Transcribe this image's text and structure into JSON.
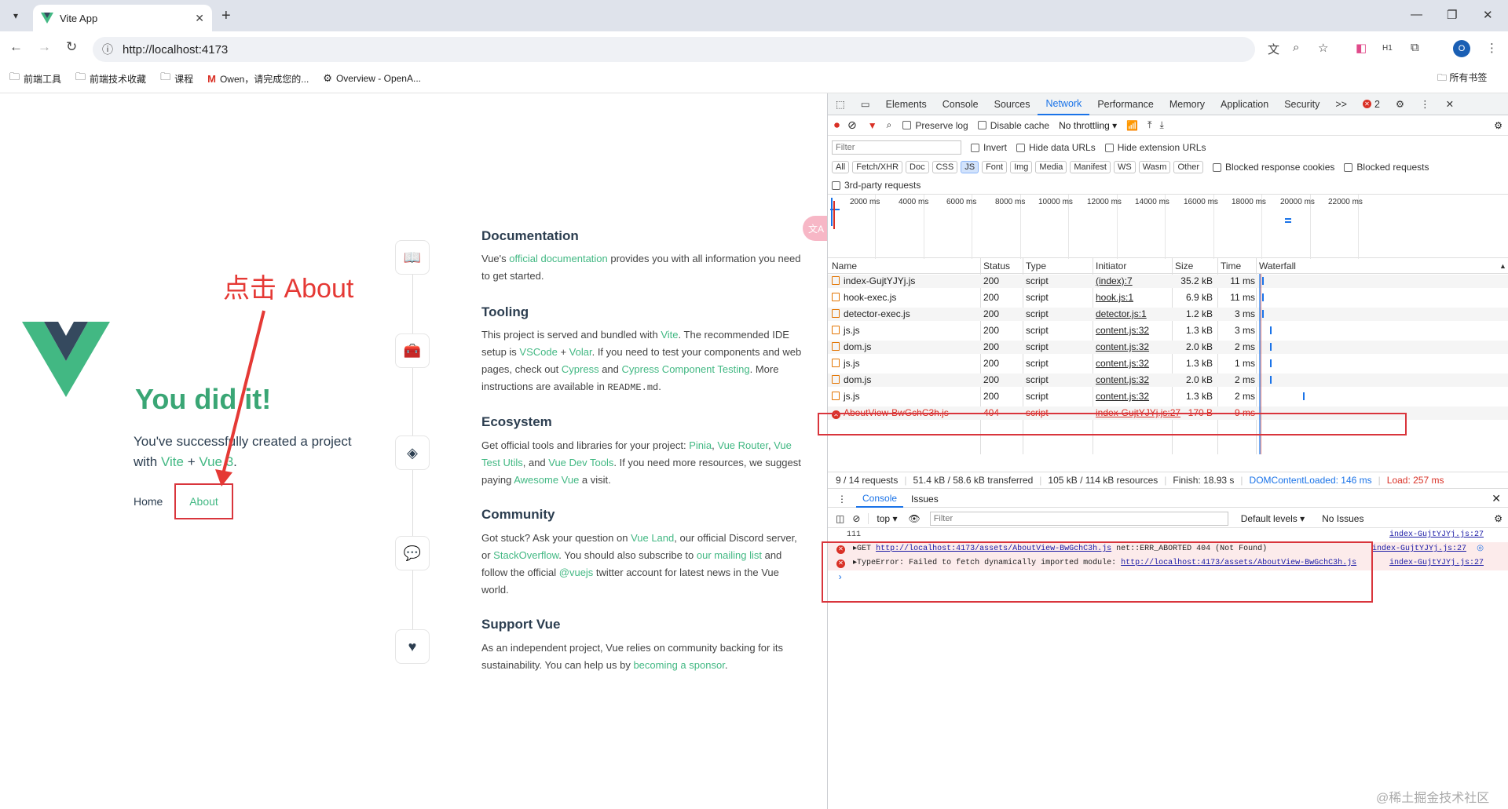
{
  "browser": {
    "tab_title": "Vite App",
    "url": "http://localhost:4173",
    "bookmarks": [
      "前端工具",
      "前端技术收藏",
      "课程",
      "Owen，请完成您的...",
      "Overview - OpenA..."
    ],
    "bookmarks_right": "所有书签",
    "profile_initial": "O"
  },
  "page": {
    "annotation": "点击 About",
    "heading": "You did it!",
    "created_prefix": "You've successfully created a project with",
    "created_vite": "Vite",
    "created_plus": "+",
    "created_vue": "Vue 3",
    "created_suffix": ".",
    "nav_home": "Home",
    "nav_about": "About",
    "translate_badge": "文A",
    "sections": [
      {
        "title": "Documentation",
        "parts": [
          "Vue's ",
          "official documentation",
          " provides you with all information you need to get started."
        ]
      },
      {
        "title": "Tooling",
        "parts": [
          "This project is served and bundled with ",
          "Vite",
          ". The recommended IDE setup is ",
          "VSCode",
          " + ",
          "Volar",
          ". If you need to test your components and web pages, check out ",
          "Cypress",
          " and ",
          "Cypress Component Testing",
          ". More instructions are available in ",
          "README.md",
          "."
        ]
      },
      {
        "title": "Ecosystem",
        "parts": [
          "Get official tools and libraries for your project: ",
          "Pinia",
          ", ",
          "Vue Router",
          ", ",
          "Vue Test Utils",
          ", and ",
          "Vue Dev Tools",
          ". If you need more resources, we suggest paying ",
          "Awesome Vue",
          " a visit."
        ]
      },
      {
        "title": "Community",
        "parts": [
          "Got stuck? Ask your question on ",
          "Vue Land",
          ", our official Discord server, or ",
          "StackOverflow",
          ". You should also subscribe to ",
          "our mailing list",
          " and follow the official ",
          "@vuejs",
          " twitter account for latest news in the Vue world."
        ]
      },
      {
        "title": "Support Vue",
        "parts": [
          "As an independent project, Vue relies on community backing for its sustainability. You can help us by ",
          "becoming a sponsor",
          "."
        ]
      }
    ]
  },
  "devtools": {
    "tabs": [
      "Elements",
      "Console",
      "Sources",
      "Network",
      "Performance",
      "Memory",
      "Application",
      "Security"
    ],
    "active_tab": "Network",
    "more": ">>",
    "error_count": "2",
    "toolbar": {
      "preserve_log": "Preserve log",
      "disable_cache": "Disable cache",
      "throttling": "No throttling"
    },
    "filter_placeholder": "Filter",
    "filter_checks": [
      "Invert",
      "Hide data URLs",
      "Hide extension URLs"
    ],
    "type_chips": [
      "All",
      "Fetch/XHR",
      "Doc",
      "CSS",
      "JS",
      "Font",
      "Img",
      "Media",
      "Manifest",
      "WS",
      "Wasm",
      "Other"
    ],
    "active_chip": "JS",
    "blocked_cookies": "Blocked response cookies",
    "blocked_requests": "Blocked requests",
    "third_party": "3rd-party requests",
    "overview_ticks": [
      "2000 ms",
      "4000 ms",
      "6000 ms",
      "8000 ms",
      "10000 ms",
      "12000 ms",
      "14000 ms",
      "16000 ms",
      "18000 ms",
      "20000 ms",
      "22000 ms"
    ],
    "columns": [
      "Name",
      "Status",
      "Type",
      "Initiator",
      "Size",
      "Time",
      "Waterfall"
    ],
    "rows": [
      {
        "name": "index-GujtYJYj.js",
        "status": "200",
        "type": "script",
        "initiator": "(index):7",
        "size": "35.2 kB",
        "time": "11 ms",
        "error": false
      },
      {
        "name": "hook-exec.js",
        "status": "200",
        "type": "script",
        "initiator": "hook.js:1",
        "size": "6.9 kB",
        "time": "11 ms",
        "error": false
      },
      {
        "name": "detector-exec.js",
        "status": "200",
        "type": "script",
        "initiator": "detector.js:1",
        "size": "1.2 kB",
        "time": "3 ms",
        "error": false
      },
      {
        "name": "js.js",
        "status": "200",
        "type": "script",
        "initiator": "content.js:32",
        "size": "1.3 kB",
        "time": "3 ms",
        "error": false
      },
      {
        "name": "dom.js",
        "status": "200",
        "type": "script",
        "initiator": "content.js:32",
        "size": "2.0 kB",
        "time": "2 ms",
        "error": false
      },
      {
        "name": "js.js",
        "status": "200",
        "type": "script",
        "initiator": "content.js:32",
        "size": "1.3 kB",
        "time": "1 ms",
        "error": false
      },
      {
        "name": "dom.js",
        "status": "200",
        "type": "script",
        "initiator": "content.js:32",
        "size": "2.0 kB",
        "time": "2 ms",
        "error": false
      },
      {
        "name": "js.js",
        "status": "200",
        "type": "script",
        "initiator": "content.js:32",
        "size": "1.3 kB",
        "time": "2 ms",
        "error": false
      },
      {
        "name": "AboutView-BwGchC3h.js",
        "status": "404",
        "type": "script",
        "initiator": "index-GujtYJYj.js:27",
        "size": "170 B",
        "time": "9 ms",
        "error": true
      }
    ],
    "status_bar": [
      "9 / 14 requests",
      "51.4 kB / 58.6 kB transferred",
      "105 kB / 114 kB resources",
      "Finish: 18.93 s",
      "DOMContentLoaded: 146 ms",
      "Load: 257 ms"
    ],
    "drawer_tabs": [
      "Console",
      "Issues"
    ],
    "console": {
      "context": "top",
      "filter_placeholder": "Filter",
      "levels": "Default levels",
      "issues": "No Issues",
      "log_value": "111",
      "log_source": "index-GujtYJYj.js:27",
      "err1_prefix": "GET ",
      "err1_url": "http://localhost:4173/assets/AboutView-BwGchC3h.js",
      "err1_suffix": " net::ERR_ABORTED 404 (Not Found)",
      "err1_source": "index-GujtYJYj.js:27",
      "err2_prefix": "TypeError: Failed to fetch dynamically imported module: ",
      "err2_url": "http://localhost:4173/assets/AboutView-BwGchC3h.js",
      "err2_source": "index-GujtYJYj.js:27",
      "prompt": "›"
    }
  },
  "watermark": "@稀土掘金技术社区",
  "colors": {
    "vue_green": "#42b883",
    "vue_dark": "#35495e",
    "annotation_red": "#d9353c",
    "devtools_blue": "#1a73e8",
    "error_red": "#d93025"
  }
}
